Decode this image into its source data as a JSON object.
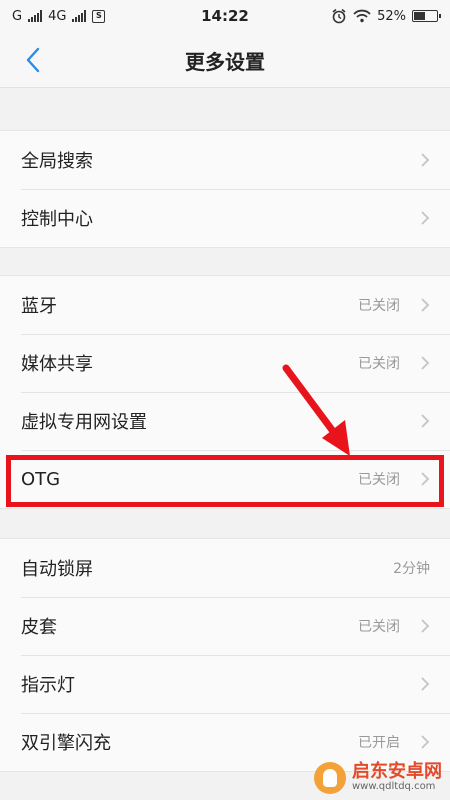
{
  "status_bar": {
    "carrier1": "G",
    "carrier2": "4G",
    "sim_badge": "S",
    "time": "14:22",
    "battery": "52%",
    "battery_level": 0.52
  },
  "nav": {
    "title": "更多设置"
  },
  "groups": [
    {
      "items": [
        {
          "label": "全局搜索",
          "value": ""
        },
        {
          "label": "控制中心",
          "value": ""
        }
      ]
    },
    {
      "items": [
        {
          "label": "蓝牙",
          "value": "已关闭"
        },
        {
          "label": "媒体共享",
          "value": "已关闭"
        },
        {
          "label": "虚拟专用网设置",
          "value": ""
        },
        {
          "label": "OTG",
          "value": "已关闭"
        }
      ]
    },
    {
      "items": [
        {
          "label": "自动锁屏",
          "value": "2分钟"
        },
        {
          "label": "皮套",
          "value": "已关闭"
        },
        {
          "label": "指示灯",
          "value": ""
        },
        {
          "label": "双引擎闪充",
          "value": "已开启"
        }
      ]
    }
  ],
  "watermark": {
    "name": "启东安卓网",
    "url": "www.qdltdq.com"
  },
  "colors": {
    "accent": "#2a8ce6",
    "highlight": "#e8131b"
  }
}
